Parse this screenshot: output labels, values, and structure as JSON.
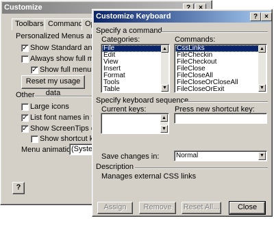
{
  "customize": {
    "title": "Customize",
    "help_btn": "?",
    "close_btn": "×",
    "tabs": [
      "Toolbars",
      "Commands",
      "Op"
    ],
    "section_label": "Personalized Menus and Toolb",
    "options": [
      {
        "label": "Show Standard and Fon",
        "checked": true
      },
      {
        "label": "Always show full menus",
        "checked": false
      },
      {
        "label": "Show full menus afte",
        "checked": true
      }
    ],
    "reset_button": "Reset my usage data",
    "other_label": "Other",
    "other_options": [
      {
        "label": "Large icons",
        "checked": false
      },
      {
        "label": "List font names in their f",
        "checked": true
      },
      {
        "label": "Show ScreenTips on too",
        "checked": true
      },
      {
        "label": "Show shortcut keys",
        "checked": false
      }
    ],
    "menu_animations_label": "Menu animations:",
    "menu_animations_value": "(System",
    "help_icon": "?"
  },
  "keyboard": {
    "title": "Customize Keyboard",
    "help_btn": "?",
    "close_btn": "×",
    "specify_command": "Specify a command",
    "categories_label": "Categories:",
    "categories": [
      "File",
      "Edit",
      "View",
      "Insert",
      "Format",
      "Tools",
      "Table"
    ],
    "commands_label": "Commands:",
    "commands": [
      "CssLinks",
      "FileCheckin",
      "FileCheckout",
      "FileClose",
      "FileCloseAll",
      "FileCloseOrCloseAll",
      "FileCloseOrExit"
    ],
    "specify_sequence": "Specify keyboard sequence",
    "current_keys_label": "Current keys:",
    "press_shortcut_label": "Press new shortcut key:",
    "save_changes_label": "Save changes in:",
    "save_changes_value": "Normal",
    "description_label": "Description",
    "description_text": "Manages external CSS links",
    "buttons": {
      "assign": "Assign",
      "remove": "Remove",
      "reset_all": "Reset All...",
      "close": "Close"
    }
  }
}
